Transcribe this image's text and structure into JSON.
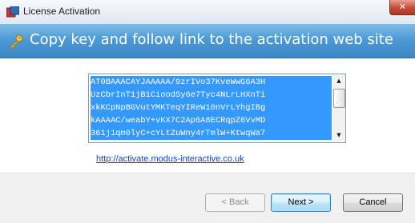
{
  "window": {
    "title": "License Activation",
    "close_label": "✕"
  },
  "banner": {
    "text": "Copy key and follow link to the activation web site",
    "icon": "key-icon"
  },
  "key_box": {
    "lines": [
      "AT0BAAACAYJAAAAA/9zrIVo37KveWwG6A3H",
      "UzCbrInT1jB1CioodSy6e7Tyc4NLrLHXnTi",
      "xkKCpNpBGVutYMKTeqYIReW10nVrLYhgIBg",
      "kAAAAC/weabY+vKX7C2Ap6A8ECRqpZ6VvMD",
      "361j1qm0lyC+cYLtZuWny4rTmlW+KtwqWa7"
    ],
    "highlight_color": "#3399ff"
  },
  "link": {
    "text": "http://activate.modus-interactive.co.uk"
  },
  "buttons": {
    "back": "< Back",
    "next": "Next >",
    "cancel": "Cancel"
  }
}
